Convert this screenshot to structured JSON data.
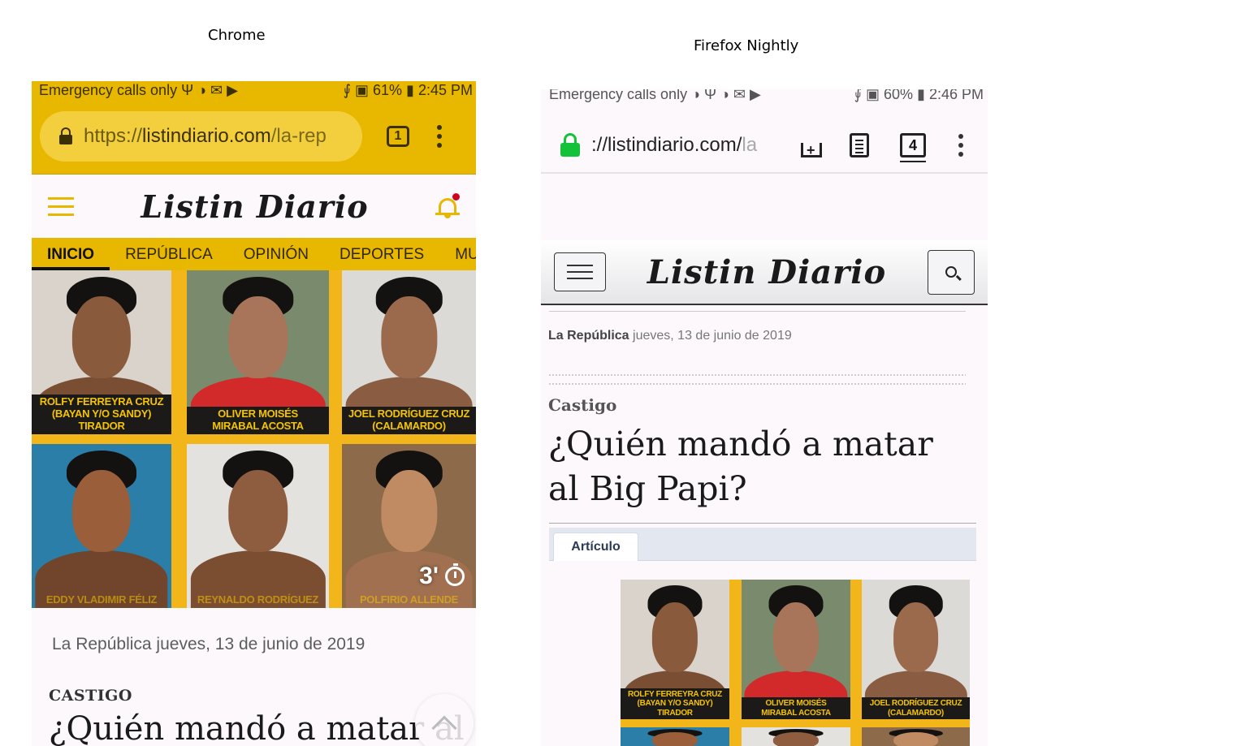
{
  "captions": {
    "left": "Chrome",
    "right": "Firefox Nightly"
  },
  "chrome": {
    "status": {
      "left": "Emergency calls only Ψ ◑ ✉ ▶",
      "right": "⨚ ▣ 61% ▮ 2:45 PM"
    },
    "url": {
      "scheme": "https://",
      "host": "listindiario.com",
      "path": "/la-rep"
    },
    "tab_count": "1",
    "logo": "Listin Diario",
    "nav_tabs": [
      "INICIO",
      "REPÚBLICA",
      "OPINIÓN",
      "DEPORTES",
      "MUN"
    ],
    "photo_names": [
      "ROLFY FERREYRA CRUZ\n(BAYAN Y/O SANDY) TIRADOR",
      "OLIVER MOISÉS\nMIRABAL ACOSTA",
      "JOEL RODRÍGUEZ CRUZ\n(CALAMARDO)",
      "EDDY VLADIMIR FÉLIZ",
      "REYNALDO RODRÍGUEZ",
      "POLFIRIO ALLENDE"
    ],
    "duration": "3'",
    "meta": "La República jueves, 13 de junio de 2019",
    "kicker": "CASTIGO",
    "headline": "¿Quién mandó a matar al"
  },
  "firefox": {
    "status": {
      "left": "Emergency calls only ◑ Ψ ◑ ✉ ▶",
      "right": "⨚ ▣ 60% ▮ 2:46 PM"
    },
    "url": {
      "text": "://listindiario.com/",
      "fade": "la"
    },
    "tab_count": "4",
    "logo": "Listin Diario",
    "meta_section": "La República",
    "meta_date": "jueves, 13 de junio de 2019",
    "kicker": "Castigo",
    "headline": "¿Quién mandó a matar al Big Papi?",
    "tab_label": "Artículo",
    "photo_names": [
      "ROLFY FERREYRA CRUZ\n(BAYAN Y/O SANDY) TIRADOR",
      "OLIVER MOISÉS\nMIRABAL ACOSTA",
      "JOEL RODRÍGUEZ CRUZ\n(CALAMARDO)"
    ]
  },
  "colors": {
    "chrome_accent": "#e8b700",
    "firefox_lock": "#14c23a",
    "photo_frame": "#f2b51a"
  }
}
